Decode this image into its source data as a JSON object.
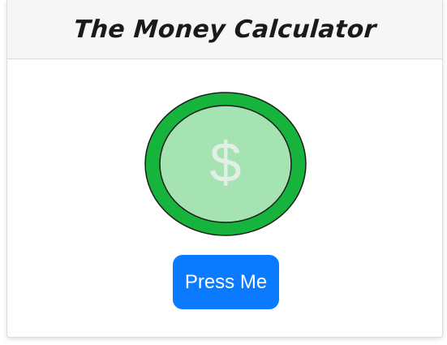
{
  "header": {
    "title": "The Money Calculator"
  },
  "coin": {
    "icon": "dollar-coin-icon",
    "symbol": "$",
    "colors": {
      "outer_ring": "#16b43c",
      "inner_face": "#a6e3b3",
      "symbol": "#e2efe5",
      "outline": "#1c1c1c"
    }
  },
  "actions": {
    "press_label": "Press Me",
    "button_color": "#0a7bff"
  }
}
